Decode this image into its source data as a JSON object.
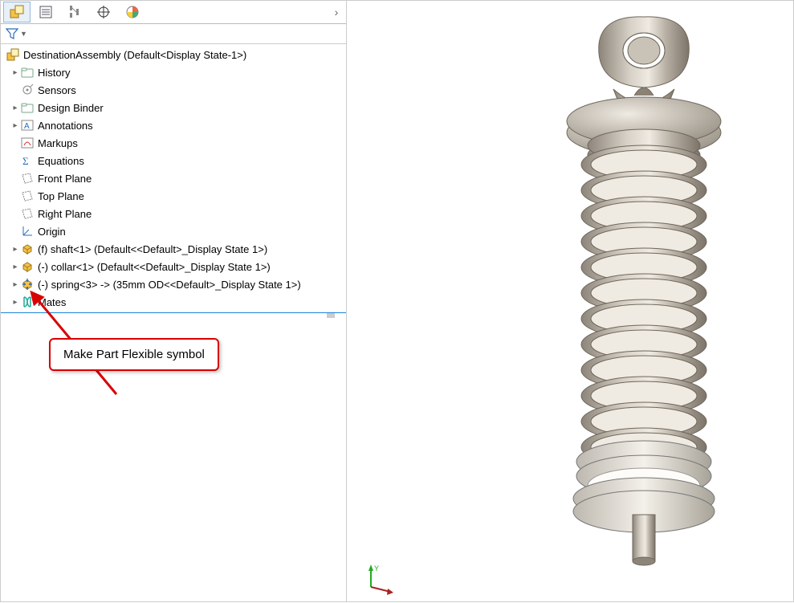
{
  "tabs": {
    "assembly": "assembly-tree",
    "properties": "configuration",
    "display": "display-manager",
    "view": "view-orientation",
    "appearance": "appearances"
  },
  "root": {
    "label": "DestinationAssembly  (Default<Display State-1>)"
  },
  "tree": [
    {
      "key": "history",
      "label": "History",
      "exp": true
    },
    {
      "key": "sensors",
      "label": "Sensors",
      "exp": false
    },
    {
      "key": "binder",
      "label": "Design Binder",
      "exp": true
    },
    {
      "key": "annot",
      "label": "Annotations",
      "exp": true
    },
    {
      "key": "markups",
      "label": "Markups",
      "exp": false
    },
    {
      "key": "equations",
      "label": "Equations",
      "exp": false
    },
    {
      "key": "frontplane",
      "label": "Front Plane",
      "exp": false
    },
    {
      "key": "topplane",
      "label": "Top Plane",
      "exp": false
    },
    {
      "key": "rightplane",
      "label": "Right Plane",
      "exp": false
    },
    {
      "key": "origin",
      "label": "Origin",
      "exp": false
    },
    {
      "key": "shaft",
      "label": "(f) shaft<1> (Default<<Default>_Display State 1>)",
      "exp": true
    },
    {
      "key": "collar",
      "label": "(-) collar<1> (Default<<Default>_Display State 1>)",
      "exp": true
    },
    {
      "key": "spring",
      "label": "(-) spring<3> -> (35mm OD<<Default>_Display State 1>)",
      "exp": true
    },
    {
      "key": "mates",
      "label": "Mates",
      "exp": true
    }
  ],
  "callout": {
    "text": "Make Part Flexible symbol"
  },
  "colors": {
    "accent": "#d90000",
    "spring": "#b6aea2",
    "shaft": "#a59d90",
    "cap": "#ebe7e1"
  }
}
